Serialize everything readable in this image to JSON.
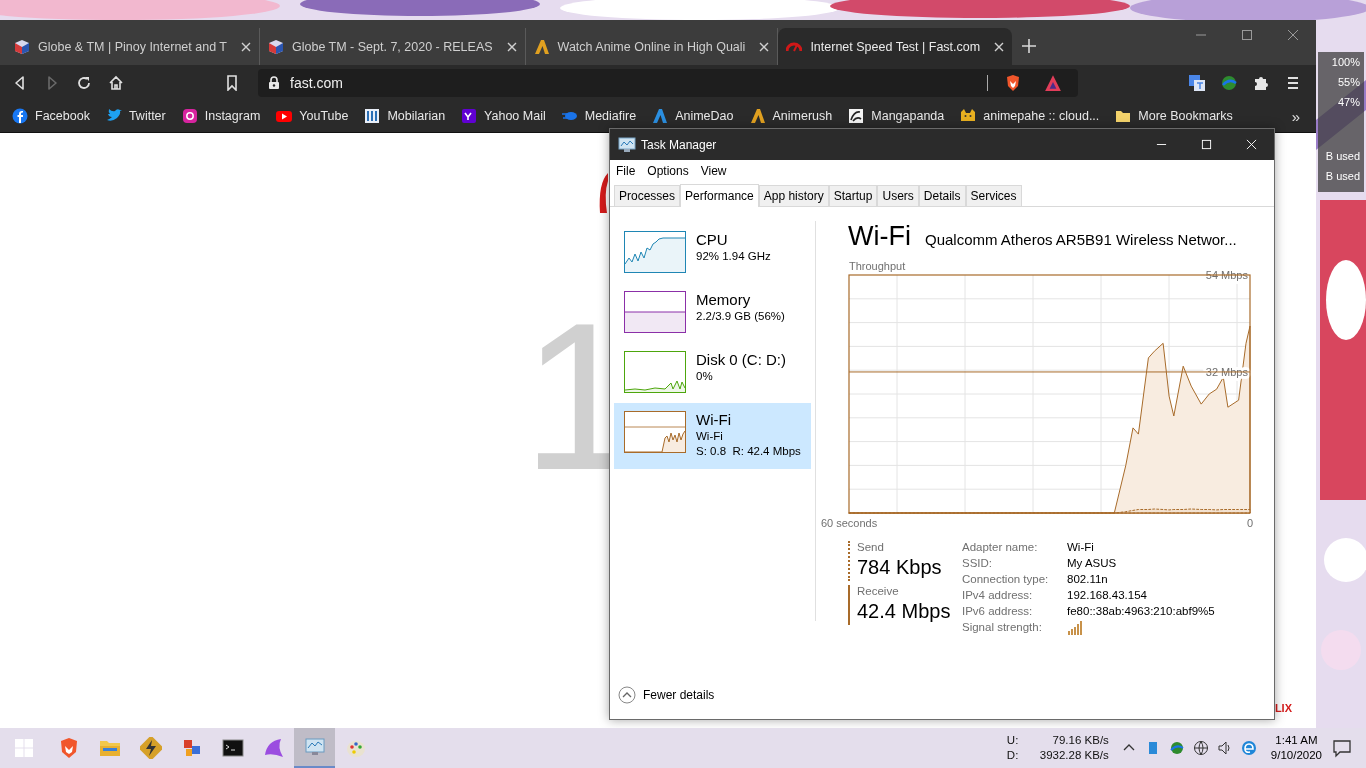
{
  "browser": {
    "tabs": [
      {
        "title": "Globe & TM | Pinoy Internet and T",
        "selected": false
      },
      {
        "title": "Globe TM - Sept. 7, 2020 - RELEAS",
        "selected": false
      },
      {
        "title": "Watch Anime Online in High Quali",
        "selected": false
      },
      {
        "title": "Internet Speed Test | Fast.com",
        "selected": true
      }
    ],
    "toolbar": {
      "back_disabled": false,
      "forward_disabled": true,
      "address": "fast.com"
    },
    "bookmarks": [
      {
        "label": "Facebook"
      },
      {
        "label": "Twitter"
      },
      {
        "label": "Instagram"
      },
      {
        "label": "YouTube"
      },
      {
        "label": "Mobilarian"
      },
      {
        "label": "Yahoo Mail"
      },
      {
        "label": "Mediafire"
      },
      {
        "label": "AnimeDao"
      },
      {
        "label": "Animerush"
      },
      {
        "label": "Mangapanda"
      },
      {
        "label": "animepahe :: cloud..."
      },
      {
        "label": "More Bookmarks"
      }
    ],
    "overflow": "»",
    "page": {
      "speed": "1",
      "footer": "LIX"
    }
  },
  "desktop_widget": {
    "lines": [
      "100%",
      "55%",
      "47%"
    ],
    "usage": [
      "B used",
      "B used"
    ]
  },
  "task_manager": {
    "title": "Task Manager",
    "menu": [
      "File",
      "Options",
      "View"
    ],
    "tabs": [
      {
        "label": "Processes",
        "selected": false
      },
      {
        "label": "Performance",
        "selected": true
      },
      {
        "label": "App history",
        "selected": false
      },
      {
        "label": "Startup",
        "selected": false
      },
      {
        "label": "Users",
        "selected": false
      },
      {
        "label": "Details",
        "selected": false
      },
      {
        "label": "Services",
        "selected": false
      }
    ],
    "resources": [
      {
        "kind": "cpu",
        "name": "CPU",
        "lines": [
          "92% 1.94 GHz"
        ],
        "selected": false
      },
      {
        "kind": "memory",
        "name": "Memory",
        "lines": [
          "2.2/3.9 GB (56%)"
        ],
        "selected": false
      },
      {
        "kind": "disk",
        "name": "Disk 0 (C: D:)",
        "lines": [
          "0%"
        ],
        "selected": false
      },
      {
        "kind": "network",
        "name": "Wi-Fi",
        "lines": [
          "Wi-Fi",
          "S: 0.8  R: 42.4 Mbps"
        ],
        "selected": true
      }
    ],
    "detail": {
      "title": "Wi-Fi",
      "adapter": "Qualcomm Atheros AR5B91 Wireless Networ...",
      "chart_data": {
        "type": "area",
        "title": "Throughput",
        "x": [
          60,
          20.3,
          18.6,
          17.5,
          16.7,
          15.2,
          14.3,
          13,
          12.1,
          11.4,
          10,
          8.8,
          7.3,
          6.1,
          5,
          4,
          3.3,
          1.7,
          0.6,
          0
        ],
        "series": [
          {
            "name": "Receive",
            "color": "#a86b2a",
            "values": [
              0,
              0,
              10.7,
              19.3,
              17.9,
              35.2,
              36.7,
              38.5,
              26.5,
              22,
              33.3,
              28.8,
              24.7,
              27,
              28.1,
              30.8,
              24,
              25.6,
              38.5,
              42.4
            ]
          },
          {
            "name": "Send",
            "color": "#a86b2a",
            "values": [
              0,
              0,
              0.3,
              0.6,
              0.8,
              0.8,
              0.9,
              0.8,
              0.7,
              0.8,
              0.8,
              0.9,
              0.8,
              0.8,
              0.7,
              0.8,
              0.8,
              0.8,
              0.8,
              0.8
            ]
          }
        ],
        "xlim": [
          60,
          0
        ],
        "ylim": [
          0,
          54
        ],
        "xticks": [
          {
            "value": 60,
            "label": "60 seconds"
          },
          {
            "value": 0,
            "label": "0"
          }
        ],
        "yticks": [
          {
            "value": 32,
            "label": "32 Mbps"
          },
          {
            "value": 54,
            "label": "54 Mbps"
          }
        ],
        "ref_lines": [
          {
            "axis": "y",
            "value": 32
          }
        ]
      },
      "send": {
        "value": "784 Kbps"
      },
      "receive": {
        "value": "42.4 Mbps"
      },
      "properties": [
        {
          "label": "Adapter name:",
          "value": "Wi-Fi"
        },
        {
          "label": "SSID:",
          "value": "My ASUS"
        },
        {
          "label": "Connection type:",
          "value": "802.11n"
        },
        {
          "label": "IPv4 address:",
          "value": "192.168.43.154"
        },
        {
          "label": "IPv6 address:",
          "value": "fe80::38ab:4963:210:abf9%5"
        },
        {
          "label": "Signal strength:",
          "kind": "signal"
        }
      ]
    },
    "fewer_details": "Fewer details"
  },
  "taskbar": {
    "apps": [
      {
        "selected": false
      },
      {
        "selected": false
      },
      {
        "selected": false
      },
      {
        "selected": false
      },
      {
        "selected": false
      },
      {
        "selected": false
      },
      {
        "selected": true
      },
      {
        "selected": false
      }
    ],
    "net": {
      "up_label": "U:",
      "up": "79.16 KB/s",
      "down_label": "D:",
      "down": "3932.28 KB/s"
    },
    "time": "1:41 AM",
    "date": "9/10/2020"
  }
}
